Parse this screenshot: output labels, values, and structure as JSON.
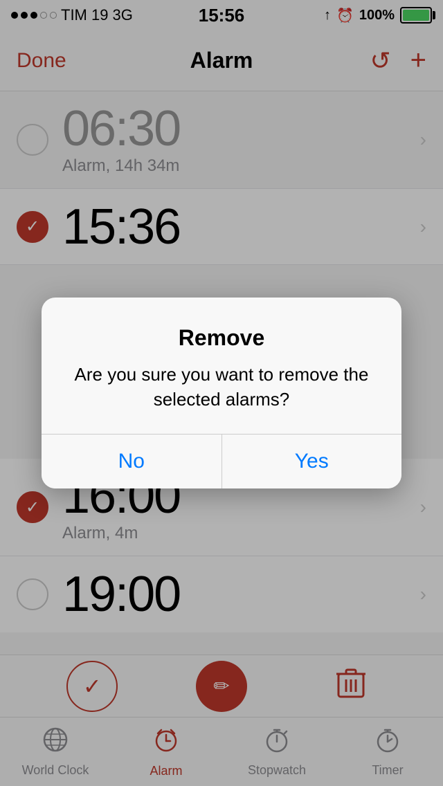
{
  "statusBar": {
    "carrier": "TIM 19",
    "network": "3G",
    "time": "15:56",
    "battery": "100%"
  },
  "navBar": {
    "done": "Done",
    "title": "Alarm",
    "refreshIcon": "↺",
    "addIcon": "+"
  },
  "alarms": [
    {
      "time": "06:30",
      "label": "Alarm, 14h 34m",
      "selected": false,
      "enabled": false
    },
    {
      "time": "15:36",
      "label": "",
      "selected": true,
      "enabled": true
    },
    {
      "time": "16:00",
      "label": "Alarm, 4m",
      "selected": true,
      "enabled": true
    },
    {
      "time": "19:00",
      "label": "",
      "selected": false,
      "enabled": false
    }
  ],
  "dialog": {
    "title": "Remove",
    "message": "Are you sure you want to remove the selected alarms?",
    "noButton": "No",
    "yesButton": "Yes"
  },
  "toolbar": {
    "checkLabel": "✓",
    "editLabel": "✏",
    "trashLabel": "🗑"
  },
  "tabBar": {
    "tabs": [
      {
        "label": "World Clock",
        "icon": "🌐",
        "active": false
      },
      {
        "label": "Alarm",
        "icon": "alarm",
        "active": true
      },
      {
        "label": "Stopwatch",
        "icon": "⏱",
        "active": false
      },
      {
        "label": "Timer",
        "icon": "⏲",
        "active": false
      }
    ]
  }
}
